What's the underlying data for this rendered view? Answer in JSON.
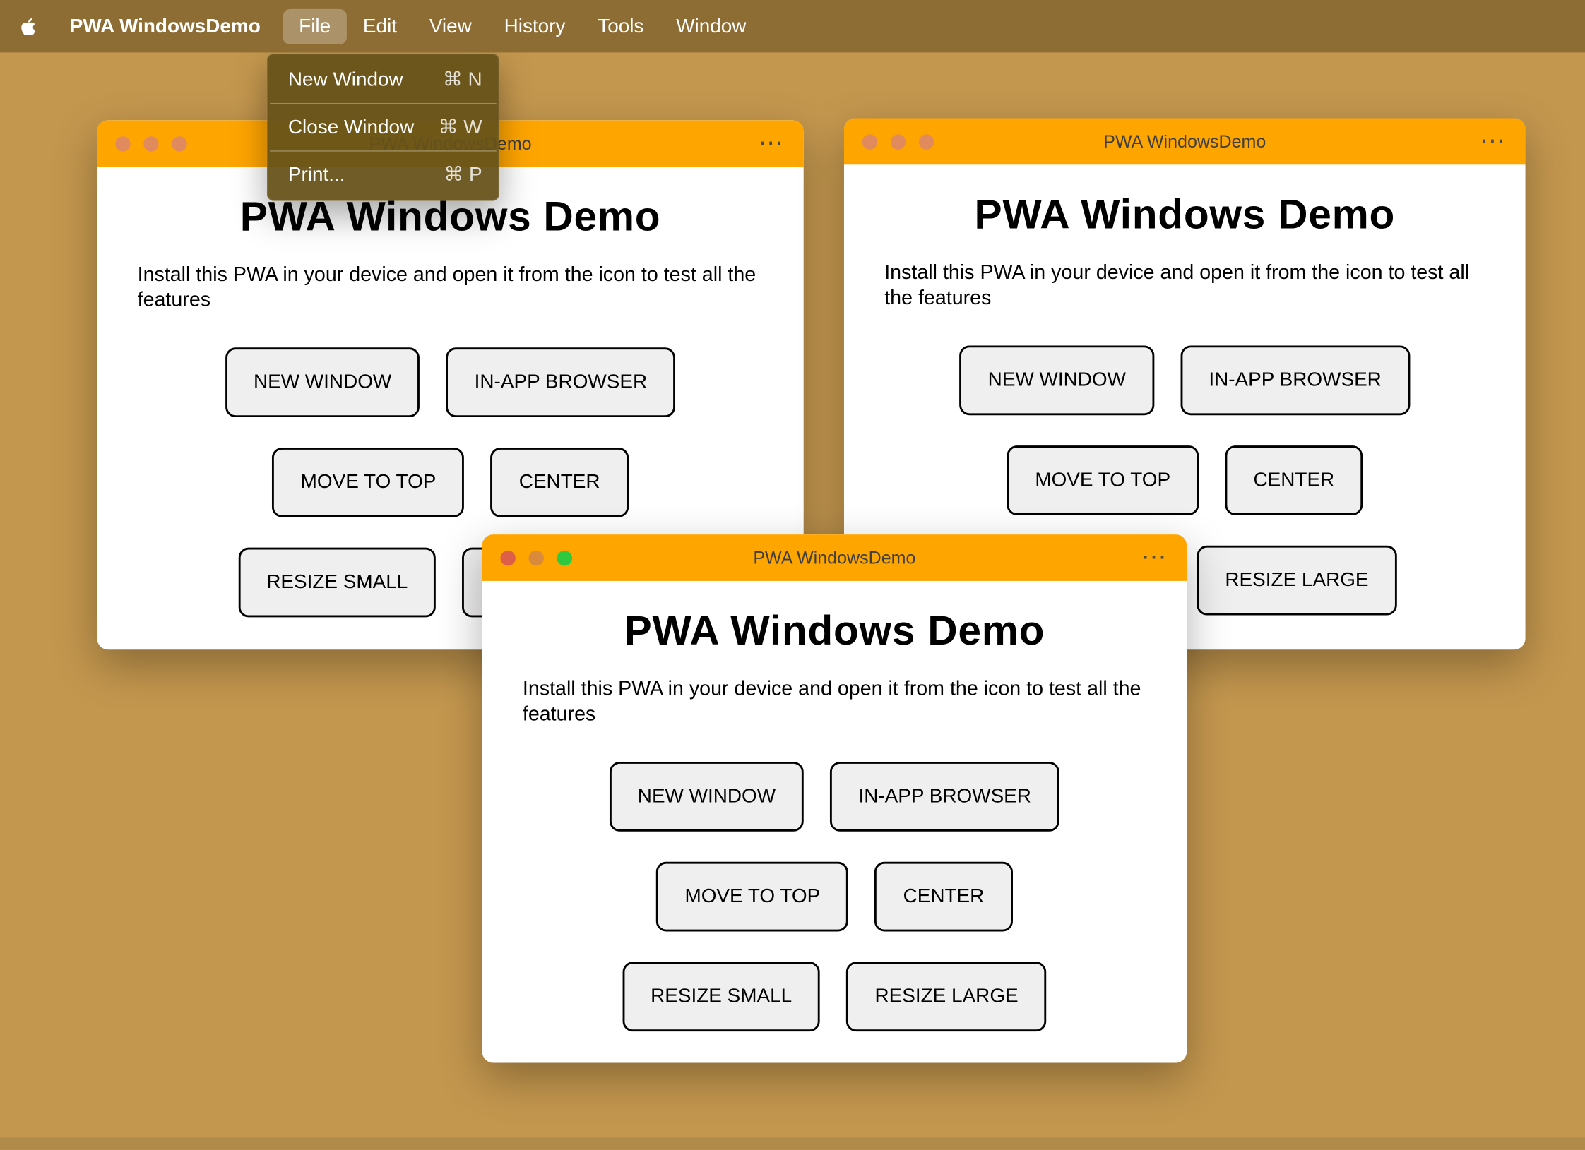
{
  "menu_bar": {
    "app_name": "PWA WindowsDemo",
    "items": [
      {
        "label": "File",
        "active": true
      },
      {
        "label": "Edit"
      },
      {
        "label": "View"
      },
      {
        "label": "History"
      },
      {
        "label": "Tools"
      },
      {
        "label": "Window"
      }
    ]
  },
  "file_menu": {
    "items": [
      {
        "label": "New Window",
        "shortcut": "⌘ N"
      },
      {
        "label": "Close Window",
        "shortcut": "⌘ W"
      },
      {
        "label": "Print...",
        "shortcut": "⌘ P"
      }
    ]
  },
  "window": {
    "title": "PWA WindowsDemo",
    "heading": "PWA Windows Demo",
    "description": "Install this PWA in your device and open it from the icon to test all the features",
    "more_label": "⋯",
    "buttons": [
      "NEW WINDOW",
      "IN-APP BROWSER",
      "MOVE TO TOP",
      "CENTER",
      "RESIZE SMALL",
      "RESIZE LARGE"
    ]
  },
  "colors": {
    "desktop": "#c4974e",
    "menu_bar": "#8e6d34",
    "menu_panel": "#66521a",
    "titlebar": "#ffa500",
    "focused_zoom_green": "#2fc93f",
    "unfocused_light": "#e08a5e"
  }
}
